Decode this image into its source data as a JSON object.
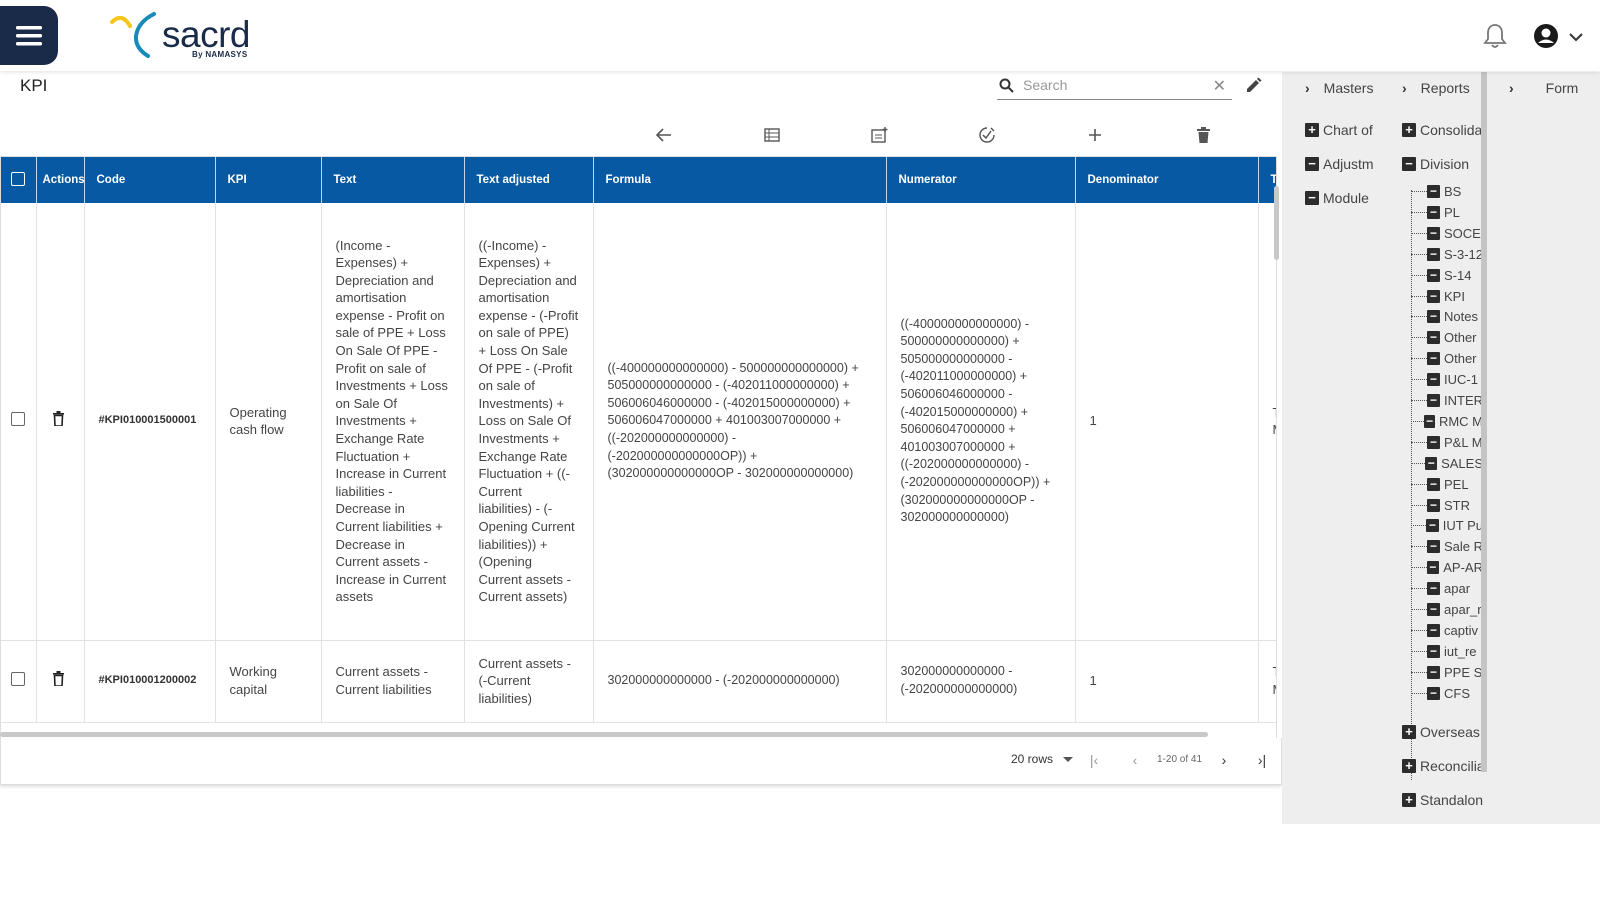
{
  "brand": {
    "name": "sacrd",
    "tagline": "By NAMASYS"
  },
  "page": {
    "title": "KPI"
  },
  "search": {
    "placeholder": "Search"
  },
  "table": {
    "columns": [
      "Actions",
      "Code",
      "KPI",
      "Text",
      "Text adjusted",
      "Formula",
      "Numerator",
      "Denominator",
      "T"
    ],
    "rows": [
      {
        "code": "#KPI010001500001",
        "kpi": "Operating cash flow",
        "text": "(Income - Expenses) + Depreciation and amortisation expense - Profit on sale of PPE + Loss On Sale Of PPE - Profit on sale of Investments + Loss on Sale Of Investments + Exchange Rate Fluctuation + Increase in Current liabilities - Decrease in Current liabilities + Decrease in Current assets - Increase in Current assets",
        "text_adjusted": "((-Income) - Expenses) + Depreciation and amortisation expense - (-Profit on sale of PPE) + Loss On Sale Of PPE - (-Profit on sale of Investments) + Loss on Sale Of Investments + Exchange Rate Fluctuation + ((-Current liabilities) - (-Opening Current liabilities)) + (Opening Current assets - Current assets)",
        "formula": "((-400000000000000) - 500000000000000) + 505000000000000 - (-402011000000000) + 506006046000000 - (-402015000000000) + 506006047000000 + 401003007000000 + ((-202000000000000) - (-202000000000000OP)) + (302000000000000OP - 302000000000000)",
        "numerator": "((-400000000000000) - 500000000000000) + 505000000000000 - (-402011000000000) + 506006046000000 - (-402015000000000) + 506006047000000 + 401003007000000 + ((-202000000000000) - (-202000000000000OP)) + (302000000000000OP - 302000000000000)",
        "denominator": "1",
        "t": "T M"
      },
      {
        "code": "#KPI010001200002",
        "kpi": "Working capital",
        "text": "Current assets - Current liabilities",
        "text_adjusted": "Current assets - (-Current liabilities)",
        "formula": "302000000000000 - (-202000000000000)",
        "numerator": "302000000000000 - (-202000000000000)",
        "denominator": "1",
        "t": "T M"
      }
    ]
  },
  "pagination": {
    "rows_per_page": "20 rows",
    "range": "1-20 of 41"
  },
  "right_panel": {
    "headers": [
      "Masters",
      "Reports",
      "Form"
    ],
    "col1": [
      "Chart of",
      "Adjustm",
      "Module"
    ],
    "col2": [
      "Consolida",
      "Division"
    ],
    "division_items": [
      "BS",
      "PL",
      "SOCE",
      "S-3-12",
      "S-14",
      "KPI",
      "Notes",
      "Other",
      "Other",
      "IUC-1",
      "INTER",
      "RMC M",
      "P&L M",
      "SALES",
      "PEL",
      "STR",
      "IUT Pu",
      "Sale R",
      "AP-AR",
      "apar",
      "apar_r",
      "captiv",
      "iut_re",
      "PPE S",
      "CFS"
    ],
    "col2_more": [
      "Overseas",
      "Reconcilia",
      "Standalon"
    ]
  },
  "colors": {
    "header_blue": "#0759a3",
    "nav_dark": "#1a2b49",
    "panel_gray": "#eeeeee"
  }
}
